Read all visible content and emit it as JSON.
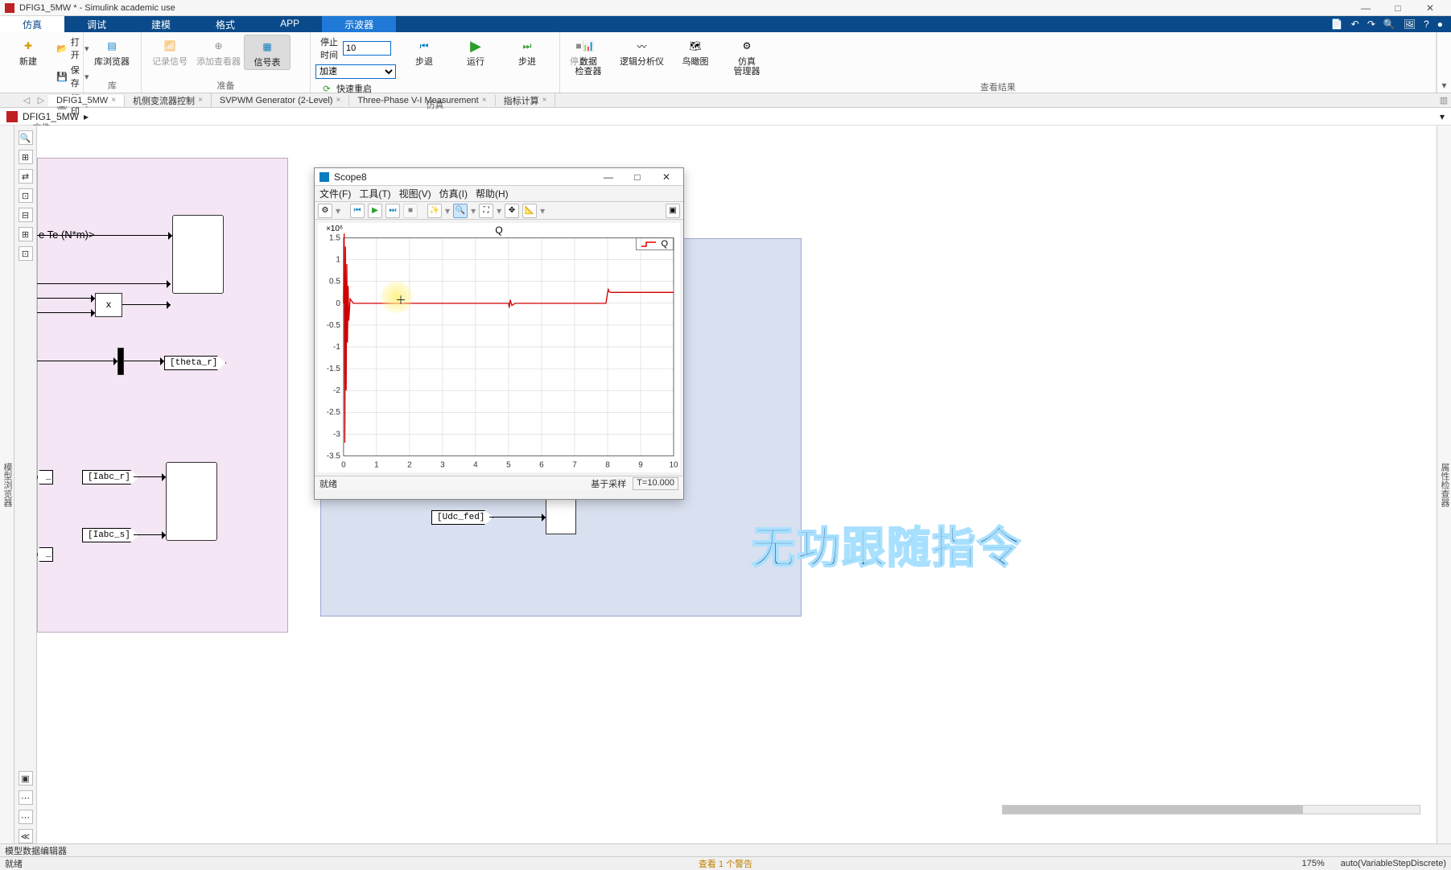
{
  "window": {
    "title": "DFIG1_5MW * - Simulink academic use",
    "minimize": "—",
    "maximize": "□",
    "close": "✕"
  },
  "tabs": {
    "items": [
      "仿真",
      "调试",
      "建模",
      "格式",
      "APP",
      "示波器"
    ],
    "active_index": 0,
    "lit_index": 5,
    "quick_icons": [
      "📄",
      "↶",
      "↷",
      "🔍",
      "🖼",
      "?",
      "●"
    ]
  },
  "ribbon": {
    "file": {
      "new": "新建",
      "open": "打开",
      "save": "保存",
      "print": "打印",
      "label": "文件"
    },
    "library": {
      "browser": "库浏览器",
      "label": "库"
    },
    "prepare": {
      "record": "记录信号",
      "add_viewer": "添加查看器",
      "signal_table": "信号表",
      "label": "准备"
    },
    "sim": {
      "stoptime_lbl": "停止时间",
      "stoptime_val": "10",
      "mode": "加速",
      "fast_restart": "快速重启",
      "stepback": "步退",
      "run": "运行",
      "stepfwd": "步进",
      "stop": "停止",
      "label": "仿真"
    },
    "review": {
      "sdi": "数据\n检查器",
      "la": "逻辑分析仪",
      "bird": "鸟瞰图",
      "simmgr": "仿真\n管理器",
      "label": "查看结果"
    }
  },
  "doctabs": {
    "items": [
      "DFIG1_5MW",
      "机侧变流器控制",
      "SVPWM Generator (2-Level)",
      "Three-Phase V-I Measurement",
      "指标计算"
    ],
    "close_x": "×",
    "active_index": 0
  },
  "breadcrumb": {
    "path": "DFIG1_5MW",
    "arrow": "▸",
    "dropdown": "▾"
  },
  "sidelabels": {
    "left": "模型浏览器",
    "right": "属性检查器"
  },
  "toolcol": [
    "🔍",
    "⊞",
    "⇄",
    "⊡",
    "⊟",
    "⊞",
    "⊡",
    "▣",
    "⋯",
    "⋯",
    "≪"
  ],
  "canvas": {
    "port_label": "e Te (N*m)>",
    "mult": "x",
    "tag_theta": "[theta_r]",
    "tag_iabcr": "[Iabc_r]",
    "tag_iabcs": "[Iabc_s]",
    "tag_r": "_r]",
    "tag_s": "_s]",
    "tag_udc": "[Udc_fed]",
    "tag_udc_arrow": "→"
  },
  "scope": {
    "title": "Scope8",
    "menus": [
      "文件(F)",
      "工具(T)",
      "视图(V)",
      "仿真(I)",
      "帮助(H)"
    ],
    "status": "就绪",
    "sample_label": "基于采样",
    "time_label": "T=10.000",
    "win": {
      "min": "—",
      "max": "□",
      "close": "✕"
    }
  },
  "overlay": "无功跟随指令",
  "footer": {
    "editor": "模型数据编辑器",
    "ready": "就绪",
    "warn": "查看 1 个警告",
    "zoom": "175%",
    "solver": "auto(VariableStepDiscrete)"
  },
  "chart_data": {
    "type": "line",
    "title": "Q",
    "y_multiplier_label": "×10⁶",
    "xlabel": "",
    "ylabel": "",
    "xlim": [
      0,
      10
    ],
    "ylim": [
      -3.5,
      1.5
    ],
    "x_ticks": [
      0,
      1,
      2,
      3,
      4,
      5,
      6,
      7,
      8,
      9,
      10
    ],
    "y_ticks": [
      -3.5,
      -3,
      -2.5,
      -2,
      -1.5,
      -1,
      -0.5,
      0,
      0.5,
      1,
      1.5
    ],
    "legend": [
      "Q"
    ],
    "series": [
      {
        "name": "Q",
        "x": [
          0,
          0.02,
          0.04,
          0.06,
          0.08,
          0.1,
          0.12,
          0.14,
          0.16,
          0.2,
          0.3,
          0.5,
          1,
          2,
          3,
          4,
          4.95,
          5,
          5.02,
          5.05,
          5.1,
          5.2,
          5.5,
          6,
          7,
          7.95,
          8,
          8.02,
          8.05,
          8.1,
          8.3,
          9,
          10
        ],
        "y": [
          0,
          1.6,
          -3.2,
          1.3,
          -2.0,
          0.9,
          -0.9,
          0.4,
          -0.4,
          0.1,
          0.0,
          0.0,
          0.0,
          0.0,
          0.0,
          0.0,
          0.0,
          0.0,
          -0.1,
          0.08,
          -0.05,
          0.0,
          0.0,
          0.0,
          0.0,
          0.0,
          0.25,
          0.32,
          0.26,
          0.25,
          0.25,
          0.25,
          0.25
        ]
      }
    ]
  }
}
